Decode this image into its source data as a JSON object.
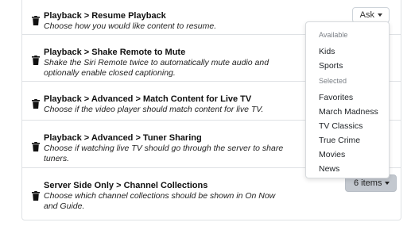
{
  "settings": [
    {
      "title": "Playback > Resume Playback",
      "description": "Choose how you would like content to resume.",
      "control": "Ask"
    },
    {
      "title": "Playback > Shake Remote to Mute",
      "description": "Shake the Siri Remote twice to automatically mute audio and optionally enable closed captioning."
    },
    {
      "title": "Playback > Advanced > Match Content for Live TV",
      "description": "Choose if the video player should match content for live TV."
    },
    {
      "title": "Playback > Advanced > Tuner Sharing",
      "description": "Choose if watching live TV should go through the server to share tuners."
    },
    {
      "title": "Server Side Only > Channel Collections",
      "description": "Choose which channel collections should be shown in On Now and Guide.",
      "control": "6 items"
    }
  ],
  "dropdown": {
    "available_header": "Available",
    "available": [
      "Kids",
      "Sports"
    ],
    "selected_header": "Selected",
    "selected": [
      "Favorites",
      "March Madness",
      "TV Classics",
      "True Crime",
      "Movies",
      "News"
    ]
  }
}
